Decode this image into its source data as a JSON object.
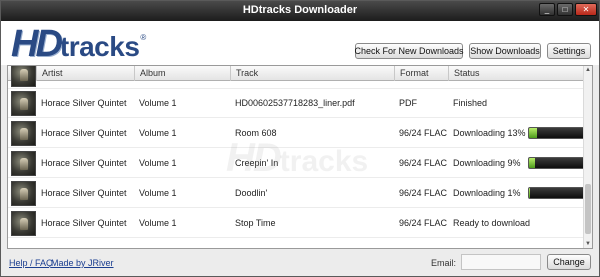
{
  "window": {
    "title": "HDtracks Downloader",
    "buttons": {
      "minimize": "_",
      "maximize": "□",
      "close": "✕"
    }
  },
  "logo": {
    "hd": "HD",
    "tracks": "tracks",
    "mark": "®"
  },
  "toolbar": {
    "check_label": "Check For New Downloads",
    "show_label": "Show Downloads",
    "settings_label": "Settings"
  },
  "table": {
    "columns": [
      "Artist",
      "Album",
      "Track",
      "Format",
      "Status"
    ],
    "rows": [
      {
        "artist": "Horace Silver Quintet",
        "album": "Volume 1",
        "track": "HD00602537718283_liner.pdf",
        "format": "PDF",
        "status": "Finished",
        "progress": null
      },
      {
        "artist": "Horace Silver Quintet",
        "album": "Volume 1",
        "track": "Room 608",
        "format": "96/24 FLAC",
        "status": "Downloading 13%",
        "progress": 13
      },
      {
        "artist": "Horace Silver Quintet",
        "album": "Volume 1",
        "track": "Creepin' In",
        "format": "96/24 FLAC",
        "status": "Downloading 9%",
        "progress": 9
      },
      {
        "artist": "Horace Silver Quintet",
        "album": "Volume 1",
        "track": "Doodlin'",
        "format": "96/24 FLAC",
        "status": "Downloading 1%",
        "progress": 1
      },
      {
        "artist": "Horace Silver Quintet",
        "album": "Volume 1",
        "track": "Stop Time",
        "format": "96/24 FLAC",
        "status": "Ready to download",
        "progress": null
      }
    ]
  },
  "watermark": {
    "hd": "HD",
    "tracks": "tracks"
  },
  "footer": {
    "help_label": "Help / FAQ",
    "jriver_label": "Made by JRiver",
    "email_label": "Email:",
    "email_value": "",
    "change_label": "Change"
  },
  "colors": {
    "accent": "#2a4a84",
    "progress_fill": "#6cc030",
    "progress_track": "#1a1a1a"
  }
}
